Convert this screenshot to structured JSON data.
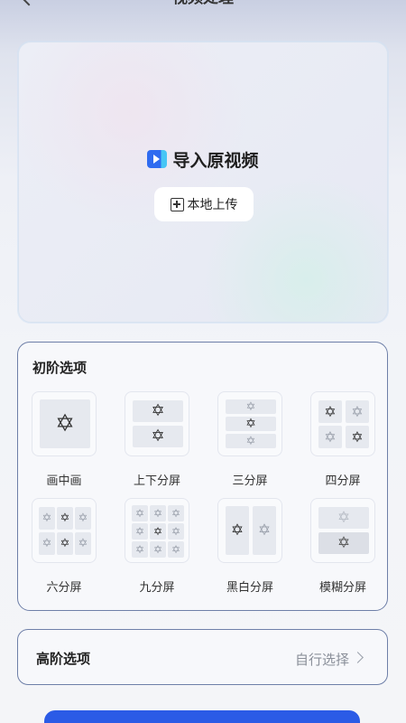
{
  "header": {
    "title": "视频处理"
  },
  "upload": {
    "import_label": "导入原视频",
    "local_button": "本地上传"
  },
  "basic": {
    "title": "初阶选项",
    "options": [
      {
        "label": "画中画"
      },
      {
        "label": "上下分屏"
      },
      {
        "label": "三分屏"
      },
      {
        "label": "四分屏"
      },
      {
        "label": "六分屏"
      },
      {
        "label": "九分屏"
      },
      {
        "label": "黑白分屏"
      },
      {
        "label": "模糊分屏"
      }
    ]
  },
  "advanced": {
    "title": "高阶选项",
    "choose": "自行选择"
  },
  "colors": {
    "accent": "#2b5be6",
    "panel_border": "#6e7fa8"
  }
}
